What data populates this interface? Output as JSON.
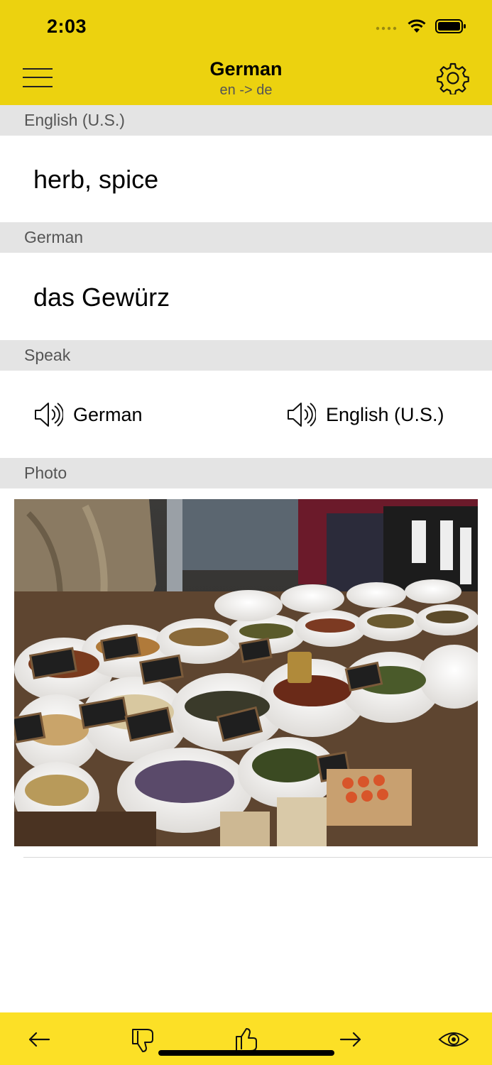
{
  "status_bar": {
    "time": "2:03"
  },
  "nav": {
    "title": "German",
    "subtitle": "en -> de"
  },
  "sections": {
    "source_label": "English (U.S.)",
    "source_text": "herb, spice",
    "target_label": "German",
    "target_text": "das Gewürz",
    "speak_label": "Speak",
    "photo_label": "Photo"
  },
  "speak": {
    "german": "German",
    "english": "English (U.S.)"
  },
  "colors": {
    "bar": "#ECD20F",
    "toolbar": "#FCE026",
    "section_header": "#E4E4E4"
  },
  "icons": [
    "menu-icon",
    "gear-icon",
    "speaker-icon",
    "back-arrow-icon",
    "thumbs-down-icon",
    "thumbs-up-icon",
    "forward-arrow-icon",
    "eye-icon"
  ]
}
